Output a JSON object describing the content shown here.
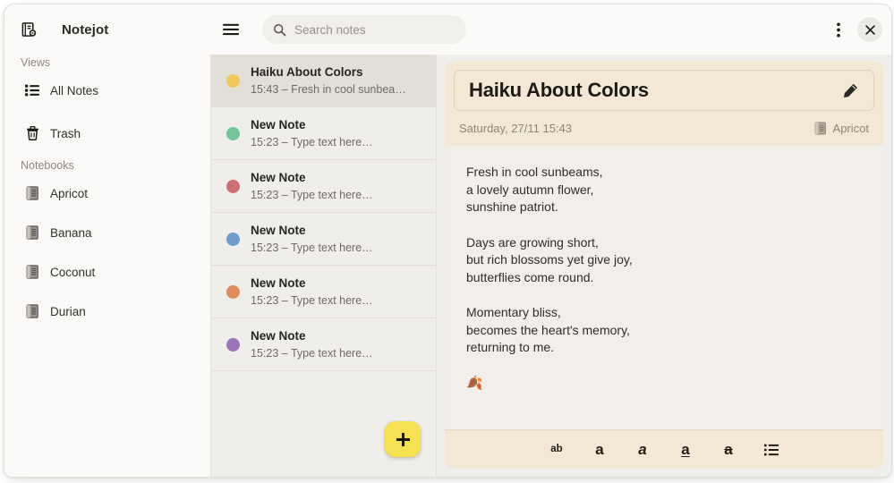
{
  "window": {
    "app_title": "Notejot"
  },
  "header": {
    "settings_icon": "notebook-gear-icon",
    "menu_icon": "hamburger-menu-icon",
    "search": {
      "icon": "search-icon",
      "placeholder": "Search notes",
      "value": ""
    },
    "more_icon": "more-vertical-icon",
    "close_icon": "close-icon"
  },
  "sidebar": {
    "views_title": "Views",
    "views": [
      {
        "label": "All Notes",
        "icon": "list-icon",
        "name": "all-notes"
      },
      {
        "label": "Trash",
        "icon": "trash-icon",
        "name": "trash"
      }
    ],
    "notebooks_title": "Notebooks",
    "notebooks": [
      {
        "label": "Apricot",
        "icon": "notebook-icon"
      },
      {
        "label": "Banana",
        "icon": "notebook-icon"
      },
      {
        "label": "Coconut",
        "icon": "notebook-icon"
      },
      {
        "label": "Durian",
        "icon": "notebook-icon"
      }
    ]
  },
  "notelist": {
    "add_button_label": "+",
    "items": [
      {
        "title": "Haiku About Colors",
        "subtitle": "15:43 – Fresh in cool sunbea…",
        "color": "#eec95a",
        "selected": true
      },
      {
        "title": "New Note",
        "subtitle": "15:23 – Type text here…",
        "color": "#72c49a",
        "selected": false
      },
      {
        "title": "New Note",
        "subtitle": "15:23 – Type text here…",
        "color": "#cd6f73",
        "selected": false
      },
      {
        "title": "New Note",
        "subtitle": "15:23 – Type text here…",
        "color": "#6e9ccd",
        "selected": false
      },
      {
        "title": "New Note",
        "subtitle": "15:23 – Type text here…",
        "color": "#e08c5c",
        "selected": false
      },
      {
        "title": "New Note",
        "subtitle": "15:23 – Type text here…",
        "color": "#9b74bb",
        "selected": false
      }
    ]
  },
  "editor": {
    "note_title": "Haiku About Colors",
    "edit_icon": "pencil-icon",
    "date": "Saturday, 27/11 15:43",
    "notebook": "Apricot",
    "notebook_icon": "notebook-icon",
    "paragraphs": [
      "Fresh in cool sunbeams,\na lovely autumn flower,\nsunshine patriot.",
      "Days are growing short,\nbut rich blossoms yet give joy,\nbutterflies come round.",
      "Momentary bliss,\nbecomes the heart's memory,\nreturning to me."
    ],
    "emoji": "🍂",
    "toolbar": [
      {
        "name": "text-format-button",
        "glyph": "ab",
        "style": "small"
      },
      {
        "name": "bold-button",
        "glyph": "a",
        "style": "bold"
      },
      {
        "name": "italic-button",
        "glyph": "a",
        "style": "ital"
      },
      {
        "name": "underline-button",
        "glyph": "a",
        "style": "und"
      },
      {
        "name": "strikethrough-button",
        "glyph": "a",
        "style": "strike"
      },
      {
        "name": "bullet-list-button",
        "glyph": "list",
        "style": "list"
      }
    ]
  },
  "colors": {
    "accent": "#f6e153",
    "header_bg": "#fbfaf8",
    "sidebar_bg": "#faf9f7",
    "list_bg": "#f0eeea",
    "editor_head_bg": "#f2e8d5",
    "editor_body_bg": "#f2efeb"
  }
}
